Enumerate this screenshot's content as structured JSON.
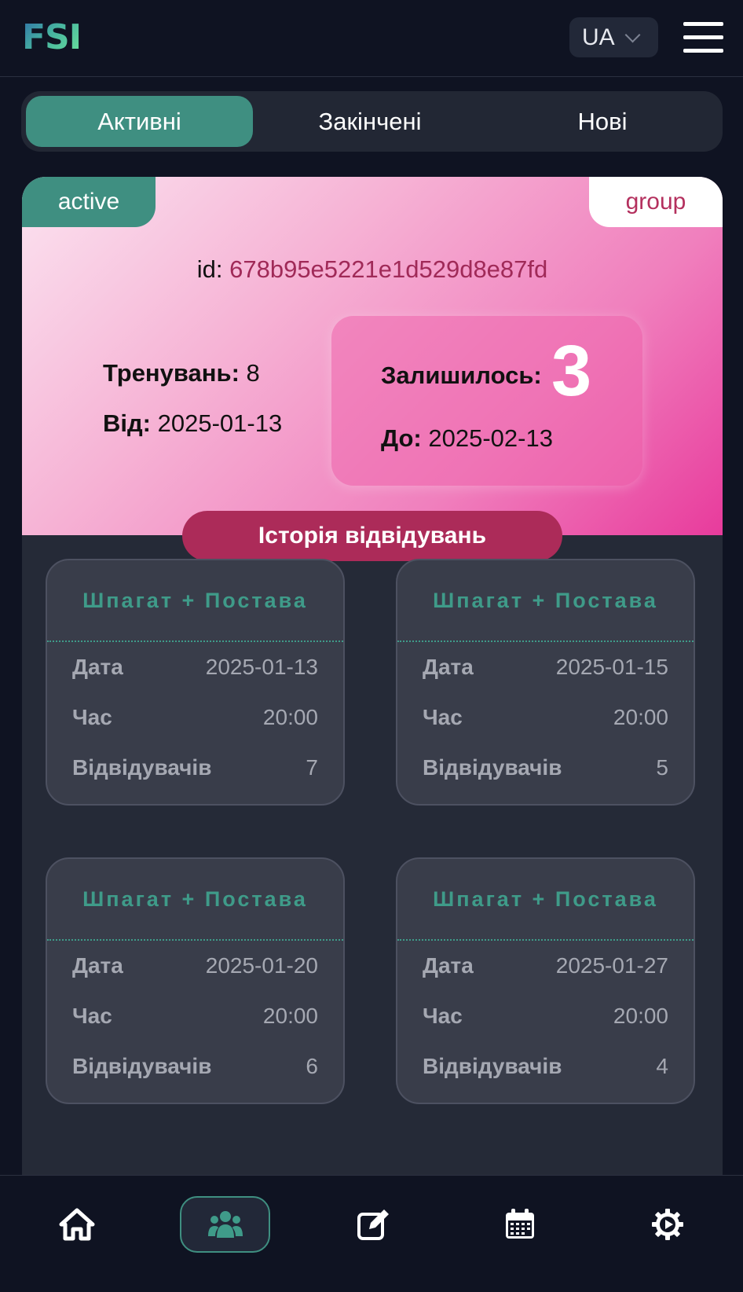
{
  "header": {
    "logo": "FSI",
    "language": "UA"
  },
  "tabs": [
    {
      "label": "Активні",
      "active": true
    },
    {
      "label": "Закінчені",
      "active": false
    },
    {
      "label": "Нові",
      "active": false
    }
  ],
  "subscription": {
    "status": "active",
    "type": "group",
    "id_label": "id:",
    "id_value": "678b95e5221e1d529d8e87fd",
    "trainings_label": "Тренувань:",
    "trainings_value": "8",
    "from_label": "Від:",
    "from_value": "2025-01-13",
    "remaining_label": "Залишилось:",
    "remaining_value": "3",
    "to_label": "До:",
    "to_value": "2025-02-13",
    "history_button": "Історія відвідувань"
  },
  "visit_labels": {
    "date": "Дата",
    "time": "Час",
    "visitors": "Відвідувачів"
  },
  "visits": [
    {
      "title": "Шпагат + Постава",
      "date": "2025-01-13",
      "time": "20:00",
      "visitors": "7"
    },
    {
      "title": "Шпагат + Постава",
      "date": "2025-01-15",
      "time": "20:00",
      "visitors": "5"
    },
    {
      "title": "Шпагат + Постава",
      "date": "2025-01-20",
      "time": "20:00",
      "visitors": "6"
    },
    {
      "title": "Шпагат + Постава",
      "date": "2025-01-27",
      "time": "20:00",
      "visitors": "4"
    }
  ],
  "bottom_nav": [
    {
      "icon": "home-icon",
      "active": false
    },
    {
      "icon": "users-group-icon",
      "active": true
    },
    {
      "icon": "edit-icon",
      "active": false
    },
    {
      "icon": "calendar-icon",
      "active": false
    },
    {
      "icon": "settings-gear-icon",
      "active": false
    }
  ],
  "colors": {
    "accent": "#3f8f81",
    "brand_pink": "#ac2b59",
    "background": "#0f1322"
  }
}
